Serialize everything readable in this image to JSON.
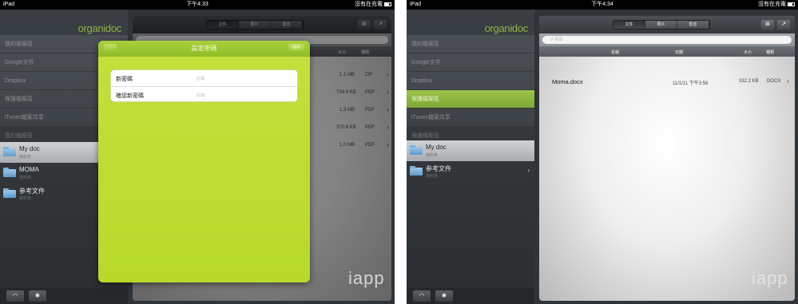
{
  "left": {
    "status": {
      "device": "iPad",
      "time": "下午4:33",
      "battery_text": "沒有在充電"
    },
    "logo": "organidoc",
    "menu": [
      "我的檔案區",
      "Google文件",
      "Dropbox",
      "保護檔案區",
      "iTunes檔案共享"
    ],
    "section_label": "我的檔案區",
    "folders": [
      {
        "name": "My doc",
        "sub": "資料夾"
      },
      {
        "name": "MOMA",
        "sub": "資料夾"
      },
      {
        "name": "参考文件",
        "sub": "資料夾"
      }
    ],
    "toolbar_tabs": [
      "文件",
      "照片",
      "影音"
    ],
    "header": {
      "size": "大小",
      "type": "種類"
    },
    "files": [
      {
        "size": "1.1 MB",
        "type": "ZIP"
      },
      {
        "size": "724.9 KB",
        "type": "PDF"
      },
      {
        "size": "1.3 MB",
        "type": "PDF"
      },
      {
        "size": "370.8 KB",
        "type": "PDF"
      },
      {
        "size": "1.0 MB",
        "type": "PDF"
      }
    ],
    "dialog": {
      "title": "設定密碼",
      "back": "‹",
      "save": "儲存",
      "new_password_label": "新密碼",
      "confirm_label": "確認新密碼",
      "required": "必填"
    },
    "watermark": "iapp"
  },
  "right": {
    "status": {
      "device": "iPad",
      "time": "下午4:34",
      "battery_text": "沒有在充電"
    },
    "logo": "organidoc",
    "menu": [
      "我的檔案區",
      "Google文件",
      "Dropbox",
      "保護檔案區",
      "iTunes檔案共享"
    ],
    "active_menu_index": 3,
    "section_label": "保護檔案區",
    "folders": [
      {
        "name": "My doc",
        "sub": "資料夾"
      },
      {
        "name": "参考文件",
        "sub": "資料夾"
      }
    ],
    "toolbar_tabs": [
      "文件",
      "照片",
      "影音"
    ],
    "search_placeholder": "搜尋",
    "header": {
      "name": "名稱",
      "date": "日期",
      "size": "大小",
      "type": "種類"
    },
    "files": [
      {
        "name": "Moma.docx",
        "date": "11/1/11 下午3:56",
        "size": "332.2 KB",
        "type": "DOCX"
      }
    ],
    "watermark": "iapp"
  },
  "colors": {
    "accent_green": "#9bc54b",
    "dialog_green": "#bfdd35",
    "sidebar_dark": "#2f3438"
  }
}
